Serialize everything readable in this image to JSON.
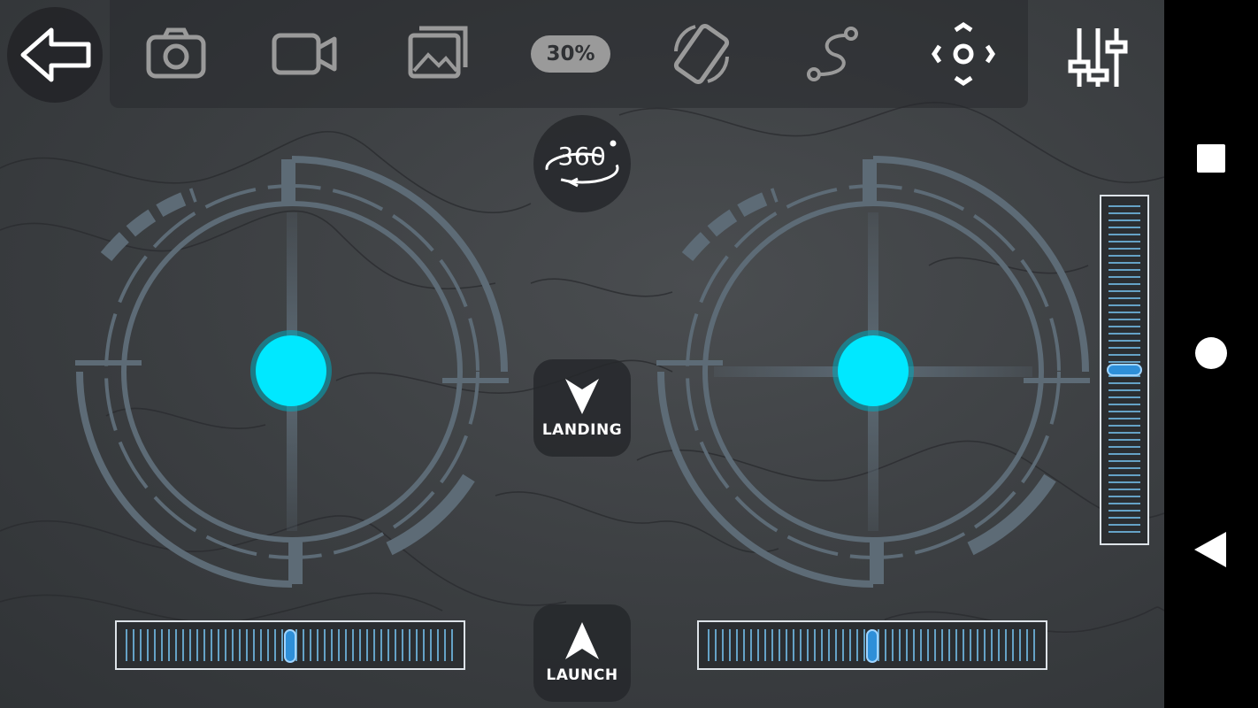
{
  "toolbar": {
    "speed_label": "30%",
    "icons": [
      "back-arrow-icon",
      "camera-icon",
      "video-camera-icon",
      "gallery-icon",
      "rotate-screen-icon",
      "flight-path-icon",
      "headless-mode-icon",
      "settings-sliders-icon"
    ]
  },
  "actions": {
    "flip_label": "360",
    "landing_label": "LANDING",
    "launch_label": "LAUNCH"
  },
  "trims": {
    "left_horizontal": 0.5,
    "right_horizontal": 0.5,
    "right_vertical": 0.5
  },
  "colors": {
    "knob": "#00e8ff",
    "ring": "#5d6b76",
    "trim_thumb": "#2e8fd8"
  },
  "system_nav": [
    "recent-apps-icon",
    "home-icon",
    "back-icon"
  ]
}
